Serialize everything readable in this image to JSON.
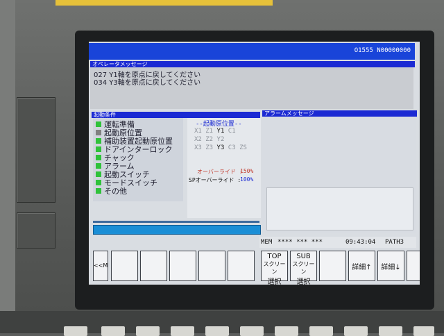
{
  "screen": {
    "prog_no": "O1555 N00000000"
  },
  "operator_message": {
    "header": "オペレータメッセージ",
    "lines": [
      "027 Y1軸を原点に戻してください",
      "034 Y3軸を原点に戻してください"
    ]
  },
  "start_conditions": {
    "header": "起動条件",
    "items": [
      {
        "label": "運転準備",
        "color": "#2fc23a"
      },
      {
        "label": "起動原位置",
        "color": "#808080"
      },
      {
        "label": "補助装置起動原位置",
        "color": "#2fc23a"
      },
      {
        "label": "ドアインターロック",
        "color": "#2fc23a"
      },
      {
        "label": "チャック",
        "color": "#2fc23a"
      },
      {
        "label": "アラーム",
        "color": "#2fc23a"
      },
      {
        "label": "起動スイッチ",
        "color": "#2fc23a"
      },
      {
        "label": "モードスイッチ",
        "color": "#2fc23a"
      },
      {
        "label": "その他",
        "color": "#2fc23a"
      }
    ]
  },
  "start_position": {
    "header": "--起動原位置--",
    "rows": [
      [
        "X1",
        "Z1",
        "Y1",
        "C1"
      ],
      [
        "X2",
        "Z2",
        "Y2",
        ""
      ],
      [
        "X3",
        "Z3",
        "Y3",
        "C3",
        "ZS"
      ]
    ],
    "override_label": "オーバーライド :",
    "override_value": "150%",
    "sp_override_label": "SPオーバーライド :",
    "sp_override_value": "100%"
  },
  "alarm_message": {
    "header": "アラームメッセージ"
  },
  "status": {
    "mode": "MEM",
    "state": "**** *** ***",
    "time": "09:43:04",
    "path": "PATH3"
  },
  "softkeys": {
    "back": "<<M",
    "top_line1": "TOP",
    "top_line2": "スクリーン",
    "top_line3": "選択",
    "sub_line1": "SUB",
    "sub_line2": "スクリーン",
    "sub_line3": "選択",
    "detail_up": "詳細↑",
    "detail_down": "詳細↓"
  },
  "colors": {
    "title_blue": "#1944d9",
    "progress_blue": "#1a8ed6",
    "ok_green": "#2fc23a",
    "override_red": "#c0392b",
    "dark_blue_text": "#1b2ad3"
  }
}
